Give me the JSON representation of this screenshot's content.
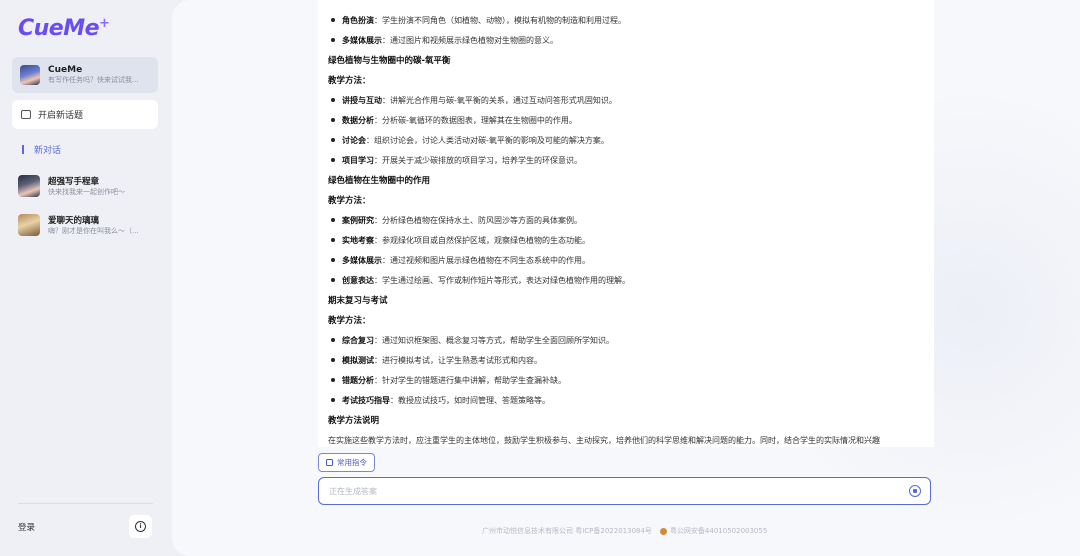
{
  "app": {
    "logo_text": "CueMe",
    "logo_plus": "+"
  },
  "sidebar": {
    "profile": {
      "name": "CueMe",
      "subtitle": "有写作任务吗？快来试试我..."
    },
    "new_topic_label": "开启新话题",
    "new_chat_label": "新对话",
    "chats": [
      {
        "name": "超强写手程章",
        "preview": "快来找我来一起创作吧～"
      },
      {
        "name": "爱聊天的璃璃",
        "preview": "嗨？刚才是你在叫我么～（..."
      }
    ],
    "login_label": "登录",
    "info_icon": "i"
  },
  "content": {
    "rows": [
      {
        "type": "bullet",
        "key": "角色扮演",
        "text": "：学生扮演不同角色（如植物、动物），模拟有机物的制造和利用过程。"
      },
      {
        "type": "bullet",
        "key": "多媒体展示",
        "text": "：通过图片和视频展示绿色植物对生物圈的意义。"
      },
      {
        "type": "heading",
        "text": "绿色植物与生物圈中的碳-氧平衡"
      },
      {
        "type": "heading",
        "text": "教学方法："
      },
      {
        "type": "bullet",
        "key": "讲授与互动",
        "text": "：讲解光合作用与碳-氧平衡的关系，通过互动问答形式巩固知识。"
      },
      {
        "type": "bullet",
        "key": "数据分析",
        "text": "：分析碳-氧循环的数据图表，理解其在生物圈中的作用。"
      },
      {
        "type": "bullet",
        "key": "讨论会",
        "text": "：组织讨论会，讨论人类活动对碳-氧平衡的影响及可能的解决方案。"
      },
      {
        "type": "bullet",
        "key": "项目学习",
        "text": "：开展关于减少碳排放的项目学习，培养学生的环保意识。"
      },
      {
        "type": "heading",
        "text": "绿色植物在生物圈中的作用"
      },
      {
        "type": "heading",
        "text": "教学方法："
      },
      {
        "type": "bullet",
        "key": "案例研究",
        "text": "：分析绿色植物在保持水土、防风固沙等方面的具体案例。"
      },
      {
        "type": "bullet",
        "key": "实地考察",
        "text": "：参观绿化项目或自然保护区域，观察绿色植物的生态功能。"
      },
      {
        "type": "bullet",
        "key": "多媒体展示",
        "text": "：通过视频和图片展示绿色植物在不同生态系统中的作用。"
      },
      {
        "type": "bullet",
        "key": "创意表达",
        "text": "：学生通过绘画、写作或制作短片等形式，表达对绿色植物作用的理解。"
      },
      {
        "type": "heading",
        "text": "期末复习与考试"
      },
      {
        "type": "heading",
        "text": "教学方法："
      },
      {
        "type": "bullet",
        "key": "综合复习",
        "text": "：通过知识框架图、概念复习等方式，帮助学生全面回顾所学知识。"
      },
      {
        "type": "bullet",
        "key": "模拟测试",
        "text": "：进行模拟考试，让学生熟悉考试形式和内容。"
      },
      {
        "type": "bullet",
        "key": "错题分析",
        "text": "：针对学生的错题进行集中讲解，帮助学生查漏补缺。"
      },
      {
        "type": "bullet",
        "key": "考试技巧指导",
        "text": "：教授应试技巧，如时间管理、答题策略等。"
      },
      {
        "type": "heading",
        "text": "教学方法说明"
      },
      {
        "type": "para",
        "text": "在实施这些教学方法时，应注重学生的主体地位，鼓励学生积极参与、主动探究，培养他们的科学思维和解决问题的能力。同时，结合学生的实际情况和兴趣"
      }
    ]
  },
  "composer": {
    "common_cmd_label": "常用指令",
    "placeholder": "正在生成答案"
  },
  "footer": {
    "company": "广州市动悦信息技术有限公司 粤ICP备2022013084号",
    "police": "粤公网安备44010502003055"
  }
}
